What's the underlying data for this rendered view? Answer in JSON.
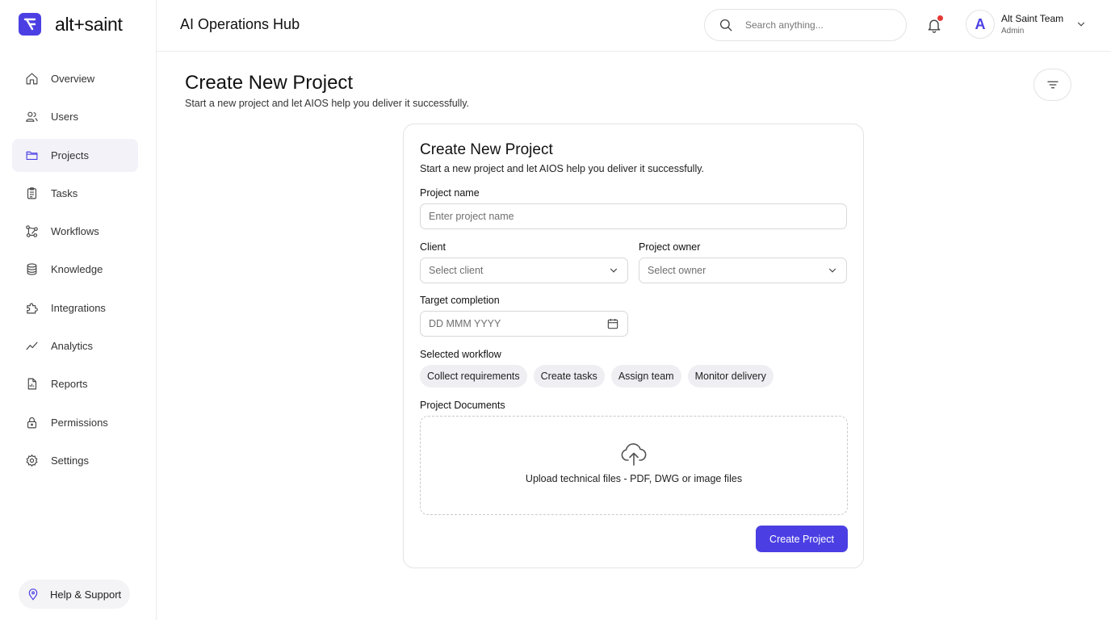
{
  "brand": {
    "logo_text": "alt+saint",
    "accent": "#4b3fe3"
  },
  "sidebar": {
    "items": [
      {
        "label": "Overview",
        "icon": "home-icon"
      },
      {
        "label": "Users",
        "icon": "users-icon"
      },
      {
        "label": "Projects",
        "icon": "folder-icon",
        "active": true
      },
      {
        "label": "Tasks",
        "icon": "clipboard-icon"
      },
      {
        "label": "Workflows",
        "icon": "workflow-icon"
      },
      {
        "label": "Knowledge",
        "icon": "database-icon"
      },
      {
        "label": "Integrations",
        "icon": "puzzle-icon"
      },
      {
        "label": "Analytics",
        "icon": "trend-line-icon"
      },
      {
        "label": "Reports",
        "icon": "report-icon"
      },
      {
        "label": "Permissions",
        "icon": "lock-icon"
      },
      {
        "label": "Settings",
        "icon": "gear-icon"
      }
    ],
    "help_label": "Help & Support"
  },
  "header": {
    "title": "AI Operations Hub",
    "search_placeholder": "Search anything...",
    "notification_dot_color": "#e53935",
    "user": {
      "initial": "A",
      "name": "Alt Saint Team",
      "role": "Admin"
    }
  },
  "page": {
    "title": "Create New Project",
    "subtitle": "Start a new project and let AIOS help you deliver it successfully."
  },
  "form": {
    "title": "Create New Project",
    "subtitle": "Start a new project and let AIOS help you deliver it successfully.",
    "project_name_label": "Project name",
    "project_name_placeholder": "Enter project name",
    "client_label": "Client",
    "client_value": "Select client",
    "owner_label": "Project owner",
    "owner_value": "Select owner",
    "target_label": "Target completion",
    "target_placeholder": "DD MMM YYYY",
    "workflow_label": "Selected workflow",
    "workflow_steps": [
      "Collect requirements",
      "Create tasks",
      "Assign team",
      "Monitor delivery"
    ],
    "documents_label": "Project Documents",
    "upload_text": "Upload technical files - PDF, DWG or image files",
    "submit_label": "Create Project"
  }
}
